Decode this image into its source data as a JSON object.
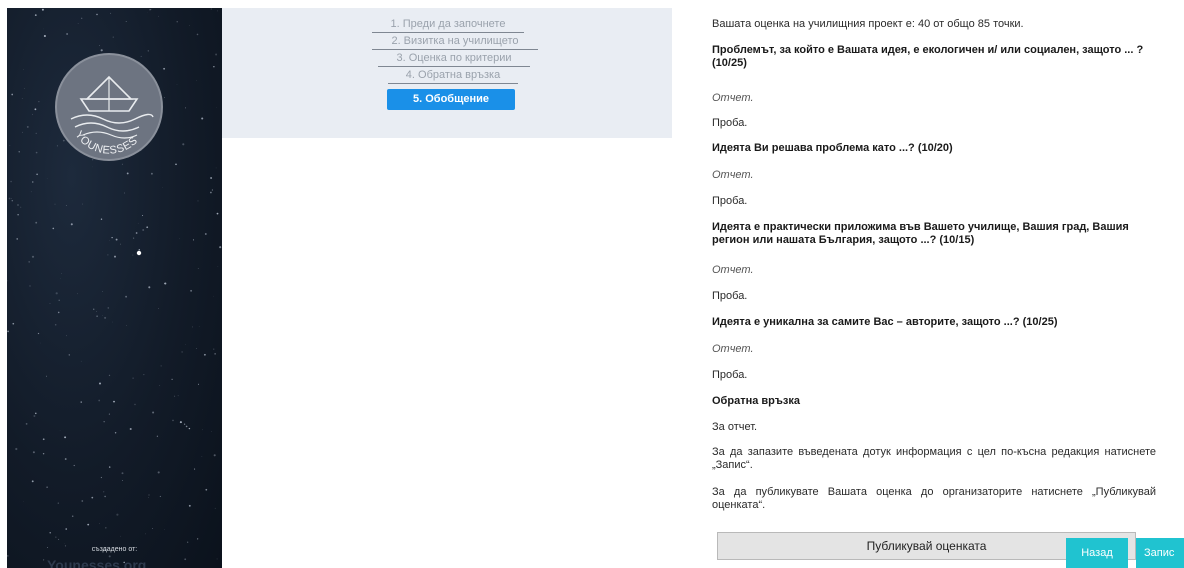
{
  "sidebar": {
    "logo_text": "YOUNESSES",
    "created_by": "създадено от:",
    "brand": "Younesses.org"
  },
  "steps": [
    {
      "label": "1. Преди да започнете"
    },
    {
      "label": "2. Визитка на училището"
    },
    {
      "label": "3. Оценка по критерии"
    },
    {
      "label": "4. Обратна връзка"
    }
  ],
  "active_step": {
    "label": "5. Обобщение"
  },
  "summary": {
    "total": "Вашата оценка на училищния проект е: 40 от общо 85 точки.",
    "criteria": [
      {
        "question": "Проблемът, за който е Вашата идея, е екологичен и/ или социален, защото ... ? (10/25)",
        "label": "Отчет.",
        "answer": "Проба."
      },
      {
        "question": "Идеята Ви решава проблема като ...? (10/20)",
        "label": "Отчет.",
        "answer": "Проба."
      },
      {
        "question": "Идеята е практически приложима във Вашето училище, Вашия град, Вашия регион или нашата България, защото ...? (10/15)",
        "label": "Отчет.",
        "answer": "Проба."
      },
      {
        "question": "Идеята е уникална за самите Вас – авторите, защото ...? (10/25)",
        "label": "Отчет.",
        "answer": "Проба."
      }
    ],
    "feedback_heading": "Обратна връзка",
    "feedback_text": "За отчет.",
    "save_info": "За да запазите въведената дотук информация с цел по-късна редакция натиснете „Запис“.",
    "publish_info": "За да публикувате Вашата оценка до организаторите натиснете „Публикувай оценката“."
  },
  "buttons": {
    "publish": "Публикувай оценката",
    "back": "Назад",
    "save": "Запис"
  },
  "colors": {
    "active_step": "#1a90e8",
    "action_button": "#20c3d0"
  }
}
